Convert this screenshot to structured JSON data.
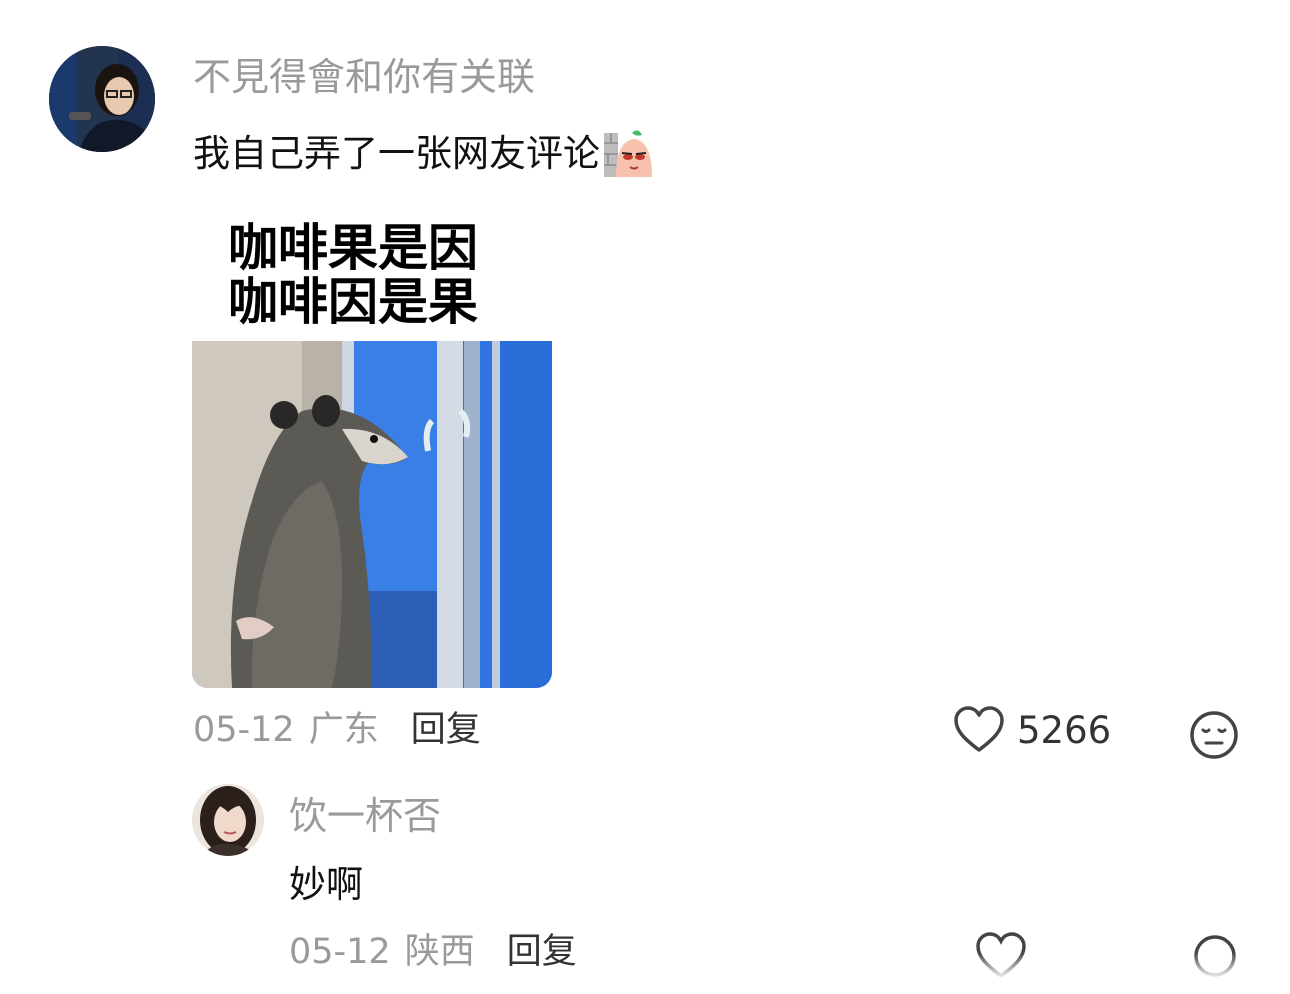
{
  "comment": {
    "username": "不見得會和你有关联",
    "text": "我自己弄了一张网友评论",
    "meme": {
      "caption_line1": "咖啡果是因",
      "caption_line2": "咖啡因是果"
    },
    "date": "05-12",
    "location": "广东",
    "reply_label": "回复",
    "like_count": "5266"
  },
  "sub_reply": {
    "username": "饮一杯否",
    "text": "妙啊",
    "date": "05-12",
    "location": "陕西",
    "reply_label": "回复"
  },
  "colors": {
    "meta_gray": "#9a9a9a",
    "text": "#111111",
    "window_blue": "#2f74e0"
  }
}
